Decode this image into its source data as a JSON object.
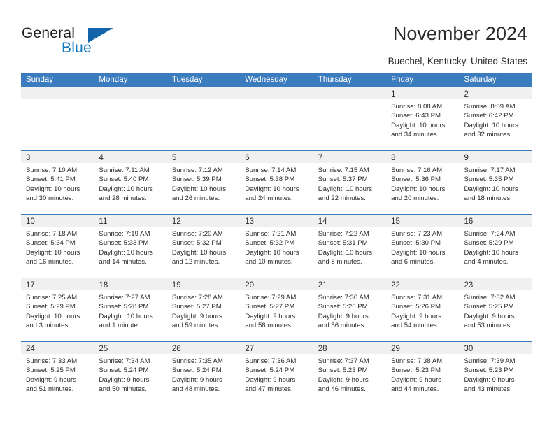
{
  "brand": {
    "name_part1": "General",
    "name_part2": "Blue",
    "flag_icon": "triangle-flag-icon",
    "accent_color": "#1165a8"
  },
  "header": {
    "title": "November 2024",
    "subtitle": "Buechel, Kentucky, United States"
  },
  "calendar": {
    "header_color": "#3a7cbe",
    "strip_color": "#f0f0f0",
    "weekdays": [
      "Sunday",
      "Monday",
      "Tuesday",
      "Wednesday",
      "Thursday",
      "Friday",
      "Saturday"
    ],
    "weeks": [
      [
        {
          "day": "",
          "empty": true,
          "sunrise": "",
          "sunset": "",
          "daylight": "",
          "daylight2": ""
        },
        {
          "day": "",
          "empty": true,
          "sunrise": "",
          "sunset": "",
          "daylight": "",
          "daylight2": ""
        },
        {
          "day": "",
          "empty": true,
          "sunrise": "",
          "sunset": "",
          "daylight": "",
          "daylight2": ""
        },
        {
          "day": "",
          "empty": true,
          "sunrise": "",
          "sunset": "",
          "daylight": "",
          "daylight2": ""
        },
        {
          "day": "",
          "empty": true,
          "sunrise": "",
          "sunset": "",
          "daylight": "",
          "daylight2": ""
        },
        {
          "day": "1",
          "empty": false,
          "sunrise": "Sunrise: 8:08 AM",
          "sunset": "Sunset: 6:43 PM",
          "daylight": "Daylight: 10 hours",
          "daylight2": "and 34 minutes."
        },
        {
          "day": "2",
          "empty": false,
          "sunrise": "Sunrise: 8:09 AM",
          "sunset": "Sunset: 6:42 PM",
          "daylight": "Daylight: 10 hours",
          "daylight2": "and 32 minutes."
        }
      ],
      [
        {
          "day": "3",
          "empty": false,
          "sunrise": "Sunrise: 7:10 AM",
          "sunset": "Sunset: 5:41 PM",
          "daylight": "Daylight: 10 hours",
          "daylight2": "and 30 minutes."
        },
        {
          "day": "4",
          "empty": false,
          "sunrise": "Sunrise: 7:11 AM",
          "sunset": "Sunset: 5:40 PM",
          "daylight": "Daylight: 10 hours",
          "daylight2": "and 28 minutes."
        },
        {
          "day": "5",
          "empty": false,
          "sunrise": "Sunrise: 7:12 AM",
          "sunset": "Sunset: 5:39 PM",
          "daylight": "Daylight: 10 hours",
          "daylight2": "and 26 minutes."
        },
        {
          "day": "6",
          "empty": false,
          "sunrise": "Sunrise: 7:14 AM",
          "sunset": "Sunset: 5:38 PM",
          "daylight": "Daylight: 10 hours",
          "daylight2": "and 24 minutes."
        },
        {
          "day": "7",
          "empty": false,
          "sunrise": "Sunrise: 7:15 AM",
          "sunset": "Sunset: 5:37 PM",
          "daylight": "Daylight: 10 hours",
          "daylight2": "and 22 minutes."
        },
        {
          "day": "8",
          "empty": false,
          "sunrise": "Sunrise: 7:16 AM",
          "sunset": "Sunset: 5:36 PM",
          "daylight": "Daylight: 10 hours",
          "daylight2": "and 20 minutes."
        },
        {
          "day": "9",
          "empty": false,
          "sunrise": "Sunrise: 7:17 AM",
          "sunset": "Sunset: 5:35 PM",
          "daylight": "Daylight: 10 hours",
          "daylight2": "and 18 minutes."
        }
      ],
      [
        {
          "day": "10",
          "empty": false,
          "sunrise": "Sunrise: 7:18 AM",
          "sunset": "Sunset: 5:34 PM",
          "daylight": "Daylight: 10 hours",
          "daylight2": "and 16 minutes."
        },
        {
          "day": "11",
          "empty": false,
          "sunrise": "Sunrise: 7:19 AM",
          "sunset": "Sunset: 5:33 PM",
          "daylight": "Daylight: 10 hours",
          "daylight2": "and 14 minutes."
        },
        {
          "day": "12",
          "empty": false,
          "sunrise": "Sunrise: 7:20 AM",
          "sunset": "Sunset: 5:32 PM",
          "daylight": "Daylight: 10 hours",
          "daylight2": "and 12 minutes."
        },
        {
          "day": "13",
          "empty": false,
          "sunrise": "Sunrise: 7:21 AM",
          "sunset": "Sunset: 5:32 PM",
          "daylight": "Daylight: 10 hours",
          "daylight2": "and 10 minutes."
        },
        {
          "day": "14",
          "empty": false,
          "sunrise": "Sunrise: 7:22 AM",
          "sunset": "Sunset: 5:31 PM",
          "daylight": "Daylight: 10 hours",
          "daylight2": "and 8 minutes."
        },
        {
          "day": "15",
          "empty": false,
          "sunrise": "Sunrise: 7:23 AM",
          "sunset": "Sunset: 5:30 PM",
          "daylight": "Daylight: 10 hours",
          "daylight2": "and 6 minutes."
        },
        {
          "day": "16",
          "empty": false,
          "sunrise": "Sunrise: 7:24 AM",
          "sunset": "Sunset: 5:29 PM",
          "daylight": "Daylight: 10 hours",
          "daylight2": "and 4 minutes."
        }
      ],
      [
        {
          "day": "17",
          "empty": false,
          "sunrise": "Sunrise: 7:25 AM",
          "sunset": "Sunset: 5:29 PM",
          "daylight": "Daylight: 10 hours",
          "daylight2": "and 3 minutes."
        },
        {
          "day": "18",
          "empty": false,
          "sunrise": "Sunrise: 7:27 AM",
          "sunset": "Sunset: 5:28 PM",
          "daylight": "Daylight: 10 hours",
          "daylight2": "and 1 minute."
        },
        {
          "day": "19",
          "empty": false,
          "sunrise": "Sunrise: 7:28 AM",
          "sunset": "Sunset: 5:27 PM",
          "daylight": "Daylight: 9 hours",
          "daylight2": "and 59 minutes."
        },
        {
          "day": "20",
          "empty": false,
          "sunrise": "Sunrise: 7:29 AM",
          "sunset": "Sunset: 5:27 PM",
          "daylight": "Daylight: 9 hours",
          "daylight2": "and 58 minutes."
        },
        {
          "day": "21",
          "empty": false,
          "sunrise": "Sunrise: 7:30 AM",
          "sunset": "Sunset: 5:26 PM",
          "daylight": "Daylight: 9 hours",
          "daylight2": "and 56 minutes."
        },
        {
          "day": "22",
          "empty": false,
          "sunrise": "Sunrise: 7:31 AM",
          "sunset": "Sunset: 5:26 PM",
          "daylight": "Daylight: 9 hours",
          "daylight2": "and 54 minutes."
        },
        {
          "day": "23",
          "empty": false,
          "sunrise": "Sunrise: 7:32 AM",
          "sunset": "Sunset: 5:25 PM",
          "daylight": "Daylight: 9 hours",
          "daylight2": "and 53 minutes."
        }
      ],
      [
        {
          "day": "24",
          "empty": false,
          "sunrise": "Sunrise: 7:33 AM",
          "sunset": "Sunset: 5:25 PM",
          "daylight": "Daylight: 9 hours",
          "daylight2": "and 51 minutes."
        },
        {
          "day": "25",
          "empty": false,
          "sunrise": "Sunrise: 7:34 AM",
          "sunset": "Sunset: 5:24 PM",
          "daylight": "Daylight: 9 hours",
          "daylight2": "and 50 minutes."
        },
        {
          "day": "26",
          "empty": false,
          "sunrise": "Sunrise: 7:35 AM",
          "sunset": "Sunset: 5:24 PM",
          "daylight": "Daylight: 9 hours",
          "daylight2": "and 48 minutes."
        },
        {
          "day": "27",
          "empty": false,
          "sunrise": "Sunrise: 7:36 AM",
          "sunset": "Sunset: 5:24 PM",
          "daylight": "Daylight: 9 hours",
          "daylight2": "and 47 minutes."
        },
        {
          "day": "28",
          "empty": false,
          "sunrise": "Sunrise: 7:37 AM",
          "sunset": "Sunset: 5:23 PM",
          "daylight": "Daylight: 9 hours",
          "daylight2": "and 46 minutes."
        },
        {
          "day": "29",
          "empty": false,
          "sunrise": "Sunrise: 7:38 AM",
          "sunset": "Sunset: 5:23 PM",
          "daylight": "Daylight: 9 hours",
          "daylight2": "and 44 minutes."
        },
        {
          "day": "30",
          "empty": false,
          "sunrise": "Sunrise: 7:39 AM",
          "sunset": "Sunset: 5:23 PM",
          "daylight": "Daylight: 9 hours",
          "daylight2": "and 43 minutes."
        }
      ]
    ]
  }
}
